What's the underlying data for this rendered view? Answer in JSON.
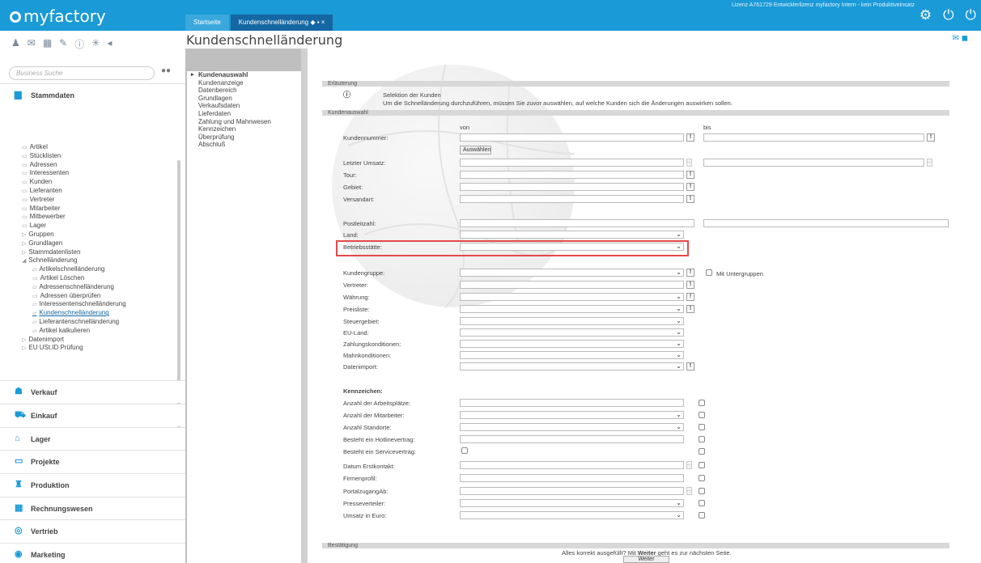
{
  "app": {
    "logo": "myfactory",
    "license": "Lizenz A761729 Entwicklerlizenz myfactory Intern - kein Produktiveinsatz"
  },
  "tabs": [
    {
      "label": "Startseite"
    },
    {
      "label": "Kundenschnelländerung"
    }
  ],
  "tab_controls": "◆ ▪ ×",
  "search": {
    "placeholder": "Business Suche"
  },
  "sidebar": {
    "sections": [
      {
        "label": "Stammdaten"
      },
      {
        "label": "Verkauf"
      },
      {
        "label": "Einkauf"
      },
      {
        "label": "Lager"
      },
      {
        "label": "Projekte"
      },
      {
        "label": "Produktion"
      },
      {
        "label": "Rechnungswesen"
      },
      {
        "label": "Vertrieb"
      },
      {
        "label": "Marketing"
      }
    ],
    "items": [
      "Artikel",
      "Stücklisten",
      "Adressen",
      "Interessenten",
      "Kunden",
      "Lieferanten",
      "Vertreter",
      "Mitarbeiter",
      "Mitbewerber",
      "Lager",
      "Gruppen",
      "Grundlagen",
      "Stammdatenlisten",
      "Schnelländerung",
      "Artikelschnelländerung",
      "Artikel Löschen",
      "Adressenschnelländerung",
      "Adressen überprüfen",
      "Interessentenschnelländerung",
      "Kundenschnelländerung",
      "Lieferantenschnelländerung",
      "Artikel kalkulieren",
      "Datenimport",
      "EU USt.ID Prüfung"
    ]
  },
  "page": {
    "title": "Kundenschnelländerung"
  },
  "wizard": {
    "steps": [
      "Kundenauswahl",
      "Kundenanzeige",
      "Datenbereich",
      "Grundlagen",
      "Verkaufsdaten",
      "Lieferdaten",
      "Zahlung und Mahnwesen",
      "Kennzeichen",
      "Überprüfung",
      "Abschluß"
    ]
  },
  "form": {
    "erlaeuterung": "Erläuterung",
    "selektion_title": "Selektion der Kunden",
    "selektion_text": "Um die Schnelländerung durchzuführen, müssen Sie zuvor auswählen, auf welche Kunden sich die Änderungen auswirken sollen.",
    "kundenauswahl": "Kundenauswahl",
    "von": "von",
    "bis": "bis",
    "kundennummer": "Kundennummer:",
    "auswaehlen": "Auswählen",
    "letzter_umsatz": "Letzter Umsatz:",
    "tour": "Tour:",
    "gebiet": "Gebiet:",
    "versandart": "Versandart:",
    "postleitzahl": "Postleitzahl:",
    "land": "Land:",
    "betriebsstaette": "Betriebsstätte:",
    "kundengruppe": "Kundengruppe:",
    "mit_untergruppen": "Mit Untergruppen",
    "vertreter": "Vertreter:",
    "waehrung": "Währung:",
    "preisliste": "Preisliste:",
    "steuergebiet": "Steuergebiet:",
    "eu_land": "EU-Land:",
    "zahlungskonditionen": "Zahlungskonditionen:",
    "mahnkonditionen": "Mahnkonditionen:",
    "datenimport": "Datenimport:",
    "kennzeichen": "Kennzeichen:",
    "arbeitsplaetze": "Anzahl der Arbeitsplätze:",
    "mitarbeiter": "Anzahl der Mitarbeiter:",
    "standorte": "Anzahl Standorte:",
    "hotline": "Besteht ein Hotlinevertrag:",
    "service": "Besteht ein Servicevertrag:",
    "erstkontakt": "Datum Erstkontakt:",
    "firmenprofil": "Firmenprofil:",
    "portal": "PortalzugangAb:",
    "presse": "Presseverteiler:",
    "umsatz": "Umsatz in Euro:",
    "bestaetigung": "Bestätigung",
    "alles_korrekt": "Alles korrekt ausgefüllt?  Mit ",
    "weiter_bold": "Weiter",
    "alles_korrekt_end": " geht es zur nächsten Seite.",
    "weiter_button": "Weiter",
    "bang": "!",
    "ellipsis": "...",
    "chevron": "⌄"
  },
  "colors": {
    "accent": "#1a9ad6",
    "highlight": "#e34a4a"
  }
}
